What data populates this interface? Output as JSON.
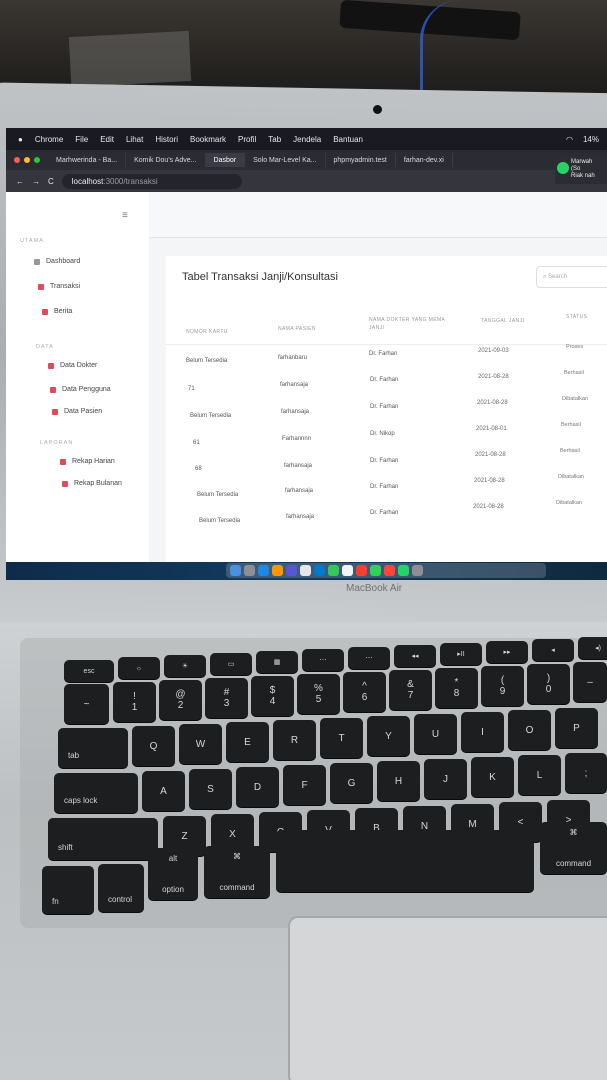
{
  "menubar": {
    "items": [
      "Chrome",
      "File",
      "Edit",
      "Lihat",
      "Histori",
      "Bookmark",
      "Profil",
      "Tab",
      "Jendela",
      "Bantuan"
    ],
    "battery": "14%"
  },
  "browser": {
    "tabs": [
      "Marhwerinda - Ba...",
      "Komik Dou's Adve...",
      "Dasbor",
      "Solo Mar-Level Ka...",
      "phpmyadmin.test",
      "farhan-dev.xi"
    ],
    "url_host": "localhost",
    "url_path": ":3000/transaksi",
    "notification_title": "Marwah (So",
    "notification_body": "Riak nah"
  },
  "sidebar": {
    "section_main": "UTAMA",
    "main_items": [
      "Dashboard",
      "Transaksi",
      "Berita"
    ],
    "section_data": "DATA",
    "data_items": [
      "Data Dokter",
      "Data Pengguna",
      "Data Pasien"
    ],
    "section_report": "LAPORAN",
    "report_items": [
      "Rekap Harian",
      "Rekap Bulanan"
    ]
  },
  "table": {
    "title": "Tabel Transaksi Janji/Konsultasi",
    "search_placeholder": "Search",
    "columns": [
      "NOMOR KARTU",
      "NAMA PASIEN",
      "NAMA DOKTER YANG MEMA JANJI",
      "TANGGAL JANJI",
      "STATUS"
    ],
    "rows": [
      [
        "Belum Tersedia",
        "farhanbaru",
        "Dr. Farhan",
        "2021-09-03",
        "Proses"
      ],
      [
        "71",
        "farhansaja",
        "Dr. Farhan",
        "2021-08-28",
        "Berhasil"
      ],
      [
        "Belum Tersedia",
        "farhansaja",
        "Dr. Farhan",
        "2021-08-28",
        "Dibatalkan"
      ],
      [
        "61",
        "Farhannnn",
        "Dr. Nikop",
        "2021-08-01",
        "Berhasil"
      ],
      [
        "68",
        "farhansaja",
        "Dr. Farhan",
        "2021-08-28",
        "Berhasil"
      ],
      [
        "Belum Tersedia",
        "farhansaja",
        "Dr. Farhan",
        "2021-08-28",
        "Dibatalkan"
      ],
      [
        "Belum Tersedia",
        "farhansaja",
        "Dr. Farhan",
        "2021-08-28",
        "Dibatalkan"
      ]
    ]
  },
  "laptop": {
    "model": "MacBook Air"
  },
  "keyboard": {
    "num_keys": [
      "~",
      "!",
      "@",
      "#",
      "$",
      "%",
      "^",
      "&",
      "*",
      "(",
      ")"
    ],
    "num_values": [
      "`",
      "1",
      "2",
      "3",
      "4",
      "5",
      "6",
      "7",
      "8",
      "9",
      "0"
    ],
    "row_q": [
      "Q",
      "W",
      "E",
      "R",
      "T",
      "Y",
      "U",
      "I",
      "O",
      "P"
    ],
    "row_a": [
      "A",
      "S",
      "D",
      "F",
      "G",
      "H",
      "J",
      "K",
      "L"
    ],
    "row_z": [
      "Z",
      "X",
      "C",
      "V",
      "B",
      "N",
      "M",
      "<",
      ">"
    ],
    "tab": "tab",
    "caps": "caps lock",
    "shift": "shift",
    "fn": "fn",
    "control": "control",
    "option": "option",
    "alt": "alt",
    "command": "command",
    "command_right": "command",
    "esc": "esc",
    "cmd_symbol": "⌘"
  },
  "colors": {
    "accent_red": "#e04b5a",
    "dock_blue": "#133a5e",
    "whatsapp": "#25d366"
  }
}
